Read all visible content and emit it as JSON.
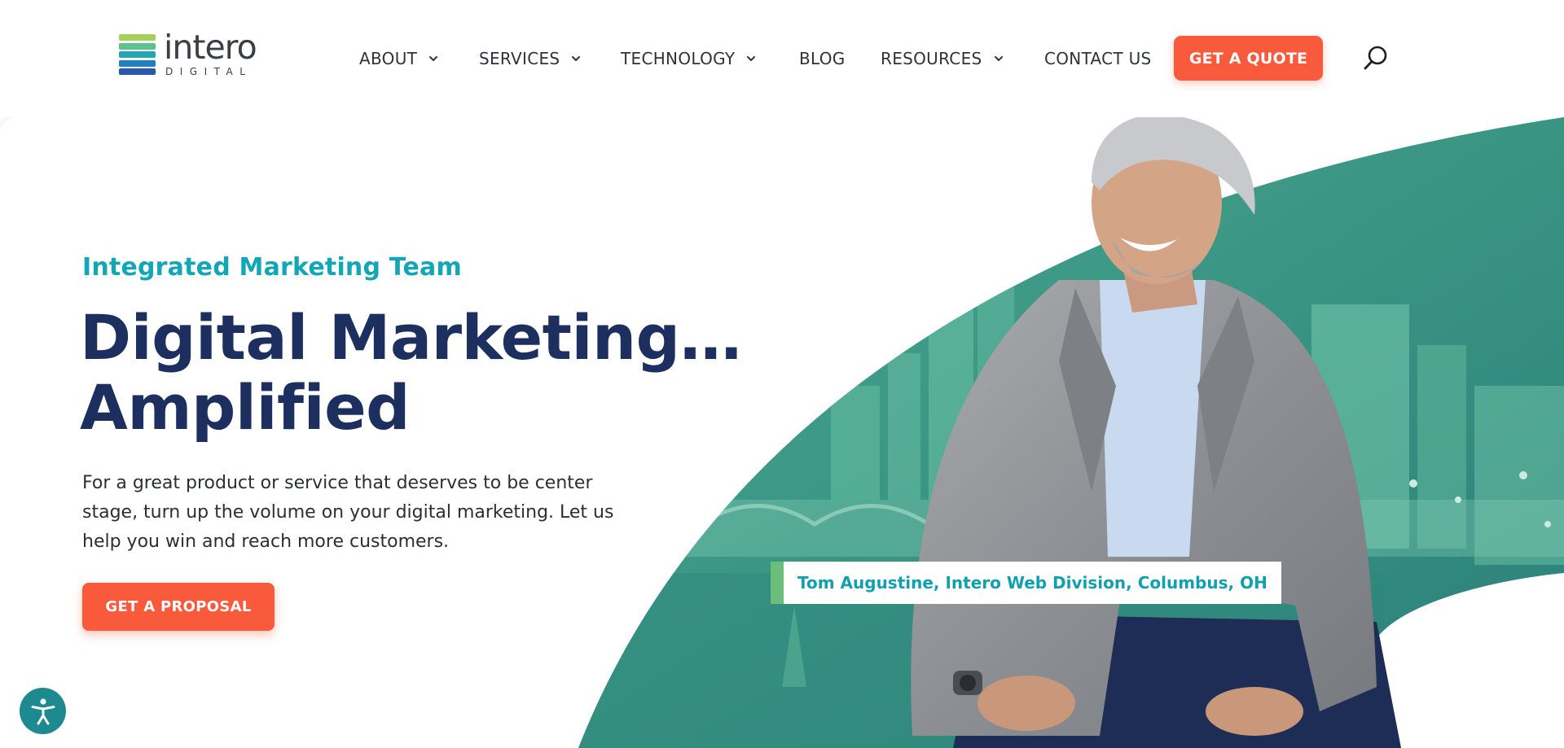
{
  "brand": {
    "name": "intero",
    "subline": "DIGITAL",
    "bar_colors": [
      "#a5d15a",
      "#5cc28d",
      "#22a7b3",
      "#1f7fbf",
      "#2a58a8"
    ]
  },
  "nav": {
    "items": [
      {
        "label": "ABOUT",
        "has_dropdown": true
      },
      {
        "label": "SERVICES",
        "has_dropdown": true
      },
      {
        "label": "TECHNOLOGY",
        "has_dropdown": true
      },
      {
        "label": "BLOG",
        "has_dropdown": false
      },
      {
        "label": "RESOURCES",
        "has_dropdown": true
      },
      {
        "label": "CONTACT US",
        "has_dropdown": false
      }
    ],
    "cta_label": "GET A QUOTE",
    "search_icon": "search-icon"
  },
  "hero": {
    "eyebrow": "Integrated Marketing Team",
    "headline_line1": "Digital Marketing…",
    "headline_line2": "Amplified",
    "body": "For a great product or service that deserves to be center stage, turn up the volume on your digital marketing. Let us help you win and reach more customers.",
    "cta_label": "GET A PROPOSAL",
    "caption": "Tom Augustine, Intero Web Division, Columbus, OH"
  },
  "accessibility": {
    "icon": "accessibility-icon"
  },
  "colors": {
    "accent_orange": "#fa5a3c",
    "teal": "#12a6b6",
    "navy": "#1c2f5e",
    "hero_teal": "#3f9d8a"
  }
}
